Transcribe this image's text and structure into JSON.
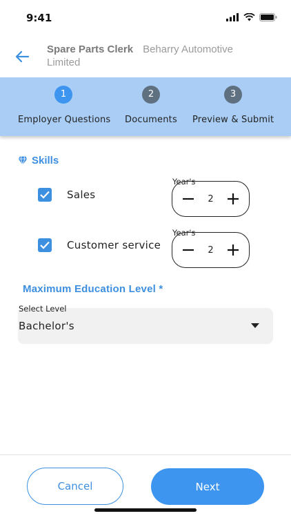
{
  "status_bar": {
    "time": "9:41"
  },
  "header": {
    "job_title": "Spare Parts Clerk",
    "company": "Beharry Automotive Limited"
  },
  "stepper": {
    "steps": [
      {
        "number": "1",
        "label": "Employer Questions",
        "active": true
      },
      {
        "number": "2",
        "label": "Documents",
        "active": false
      },
      {
        "number": "3",
        "label": "Preview & Submit",
        "active": false
      }
    ]
  },
  "skills": {
    "title": "Skills",
    "items": [
      {
        "name": "Sales",
        "checked": true,
        "years_label": "Year's",
        "years": "2"
      },
      {
        "name": "Customer service",
        "checked": true,
        "years_label": "Year's",
        "years": "2"
      }
    ]
  },
  "education": {
    "title": "Maximum Education Level *",
    "select_label": "Select Level",
    "selected_value": "Bachelor's"
  },
  "footer": {
    "cancel_label": "Cancel",
    "next_label": "Next"
  },
  "colors": {
    "accent": "#3d8fe0",
    "stepper_bg": "#a9cdf4",
    "step_active": "#3d95f0",
    "step_inactive": "#5f7081",
    "next_button": "#3d95f0"
  }
}
